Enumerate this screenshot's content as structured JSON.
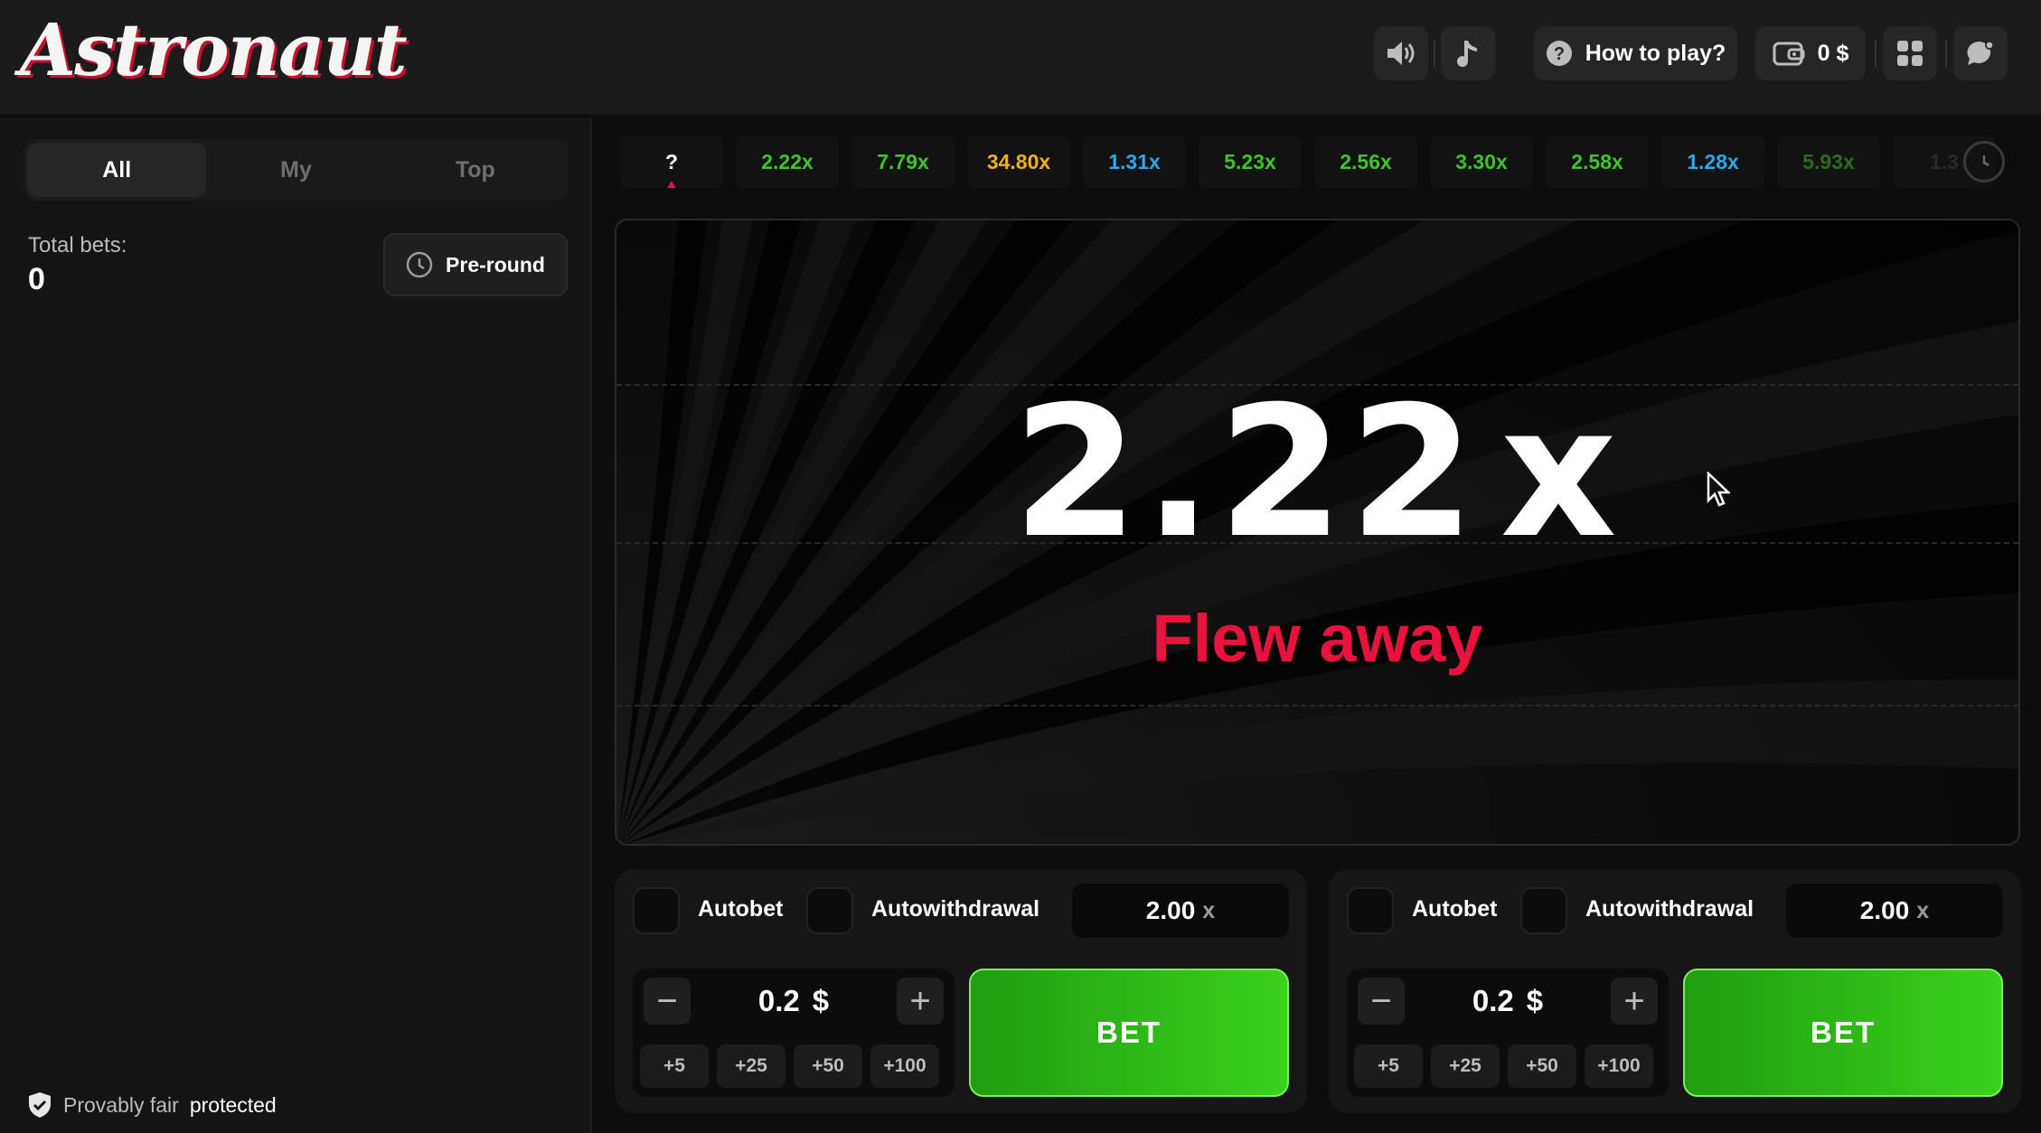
{
  "app": {
    "logo_text": "Astronaut"
  },
  "topbar": {
    "how_to_play": "How to play?",
    "balance": "0 $",
    "icons": [
      "speaker-icon",
      "music-note-icon",
      "question-icon",
      "wallet-icon",
      "grid-icon",
      "chat-icon"
    ]
  },
  "left_panel": {
    "tabs": [
      "All",
      "My",
      "Top"
    ],
    "active_tab": "All",
    "total_bets_label": "Total bets:",
    "total_bets_value": "0",
    "preround_label": "Pre-round",
    "fair_label": "Provably fair",
    "fair_status": "protected"
  },
  "history": [
    {
      "label": "?",
      "color": "#ffffff"
    },
    {
      "label": "2.22x",
      "color": "#3ec42a"
    },
    {
      "label": "7.79x",
      "color": "#3ec42a"
    },
    {
      "label": "34.80x",
      "color": "#f2b01e"
    },
    {
      "label": "1.31x",
      "color": "#2fa8ea"
    },
    {
      "label": "5.23x",
      "color": "#3ec42a"
    },
    {
      "label": "2.56x",
      "color": "#3ec42a"
    },
    {
      "label": "3.30x",
      "color": "#3ec42a"
    },
    {
      "label": "2.58x",
      "color": "#3ec42a"
    },
    {
      "label": "1.28x",
      "color": "#2fa8ea"
    },
    {
      "label": "5.93x",
      "color": "#2b6b22"
    },
    {
      "label": "1.3",
      "color": "#2a2a2a"
    }
  ],
  "game": {
    "multiplier": "2.22",
    "multiplier_suffix": "x",
    "status": "Flew away"
  },
  "bet_panels": [
    {
      "autobet_label": "Autobet",
      "autowithdrawal_label": "Autowithdrawal",
      "auto_multiplier": "2.00",
      "auto_multiplier_suffix": "x",
      "amount": "0.2",
      "currency": "$",
      "quick": [
        "+5",
        "+25",
        "+50",
        "+100"
      ],
      "bet_label": "BET"
    },
    {
      "autobet_label": "Autobet",
      "autowithdrawal_label": "Autowithdrawal",
      "auto_multiplier": "2.00",
      "auto_multiplier_suffix": "x",
      "amount": "0.2",
      "currency": "$",
      "quick": [
        "+5",
        "+25",
        "+50",
        "+100"
      ],
      "bet_label": "BET"
    }
  ],
  "colors": {
    "accent_red": "#e8123c",
    "bet_green": "#3bd01e"
  }
}
